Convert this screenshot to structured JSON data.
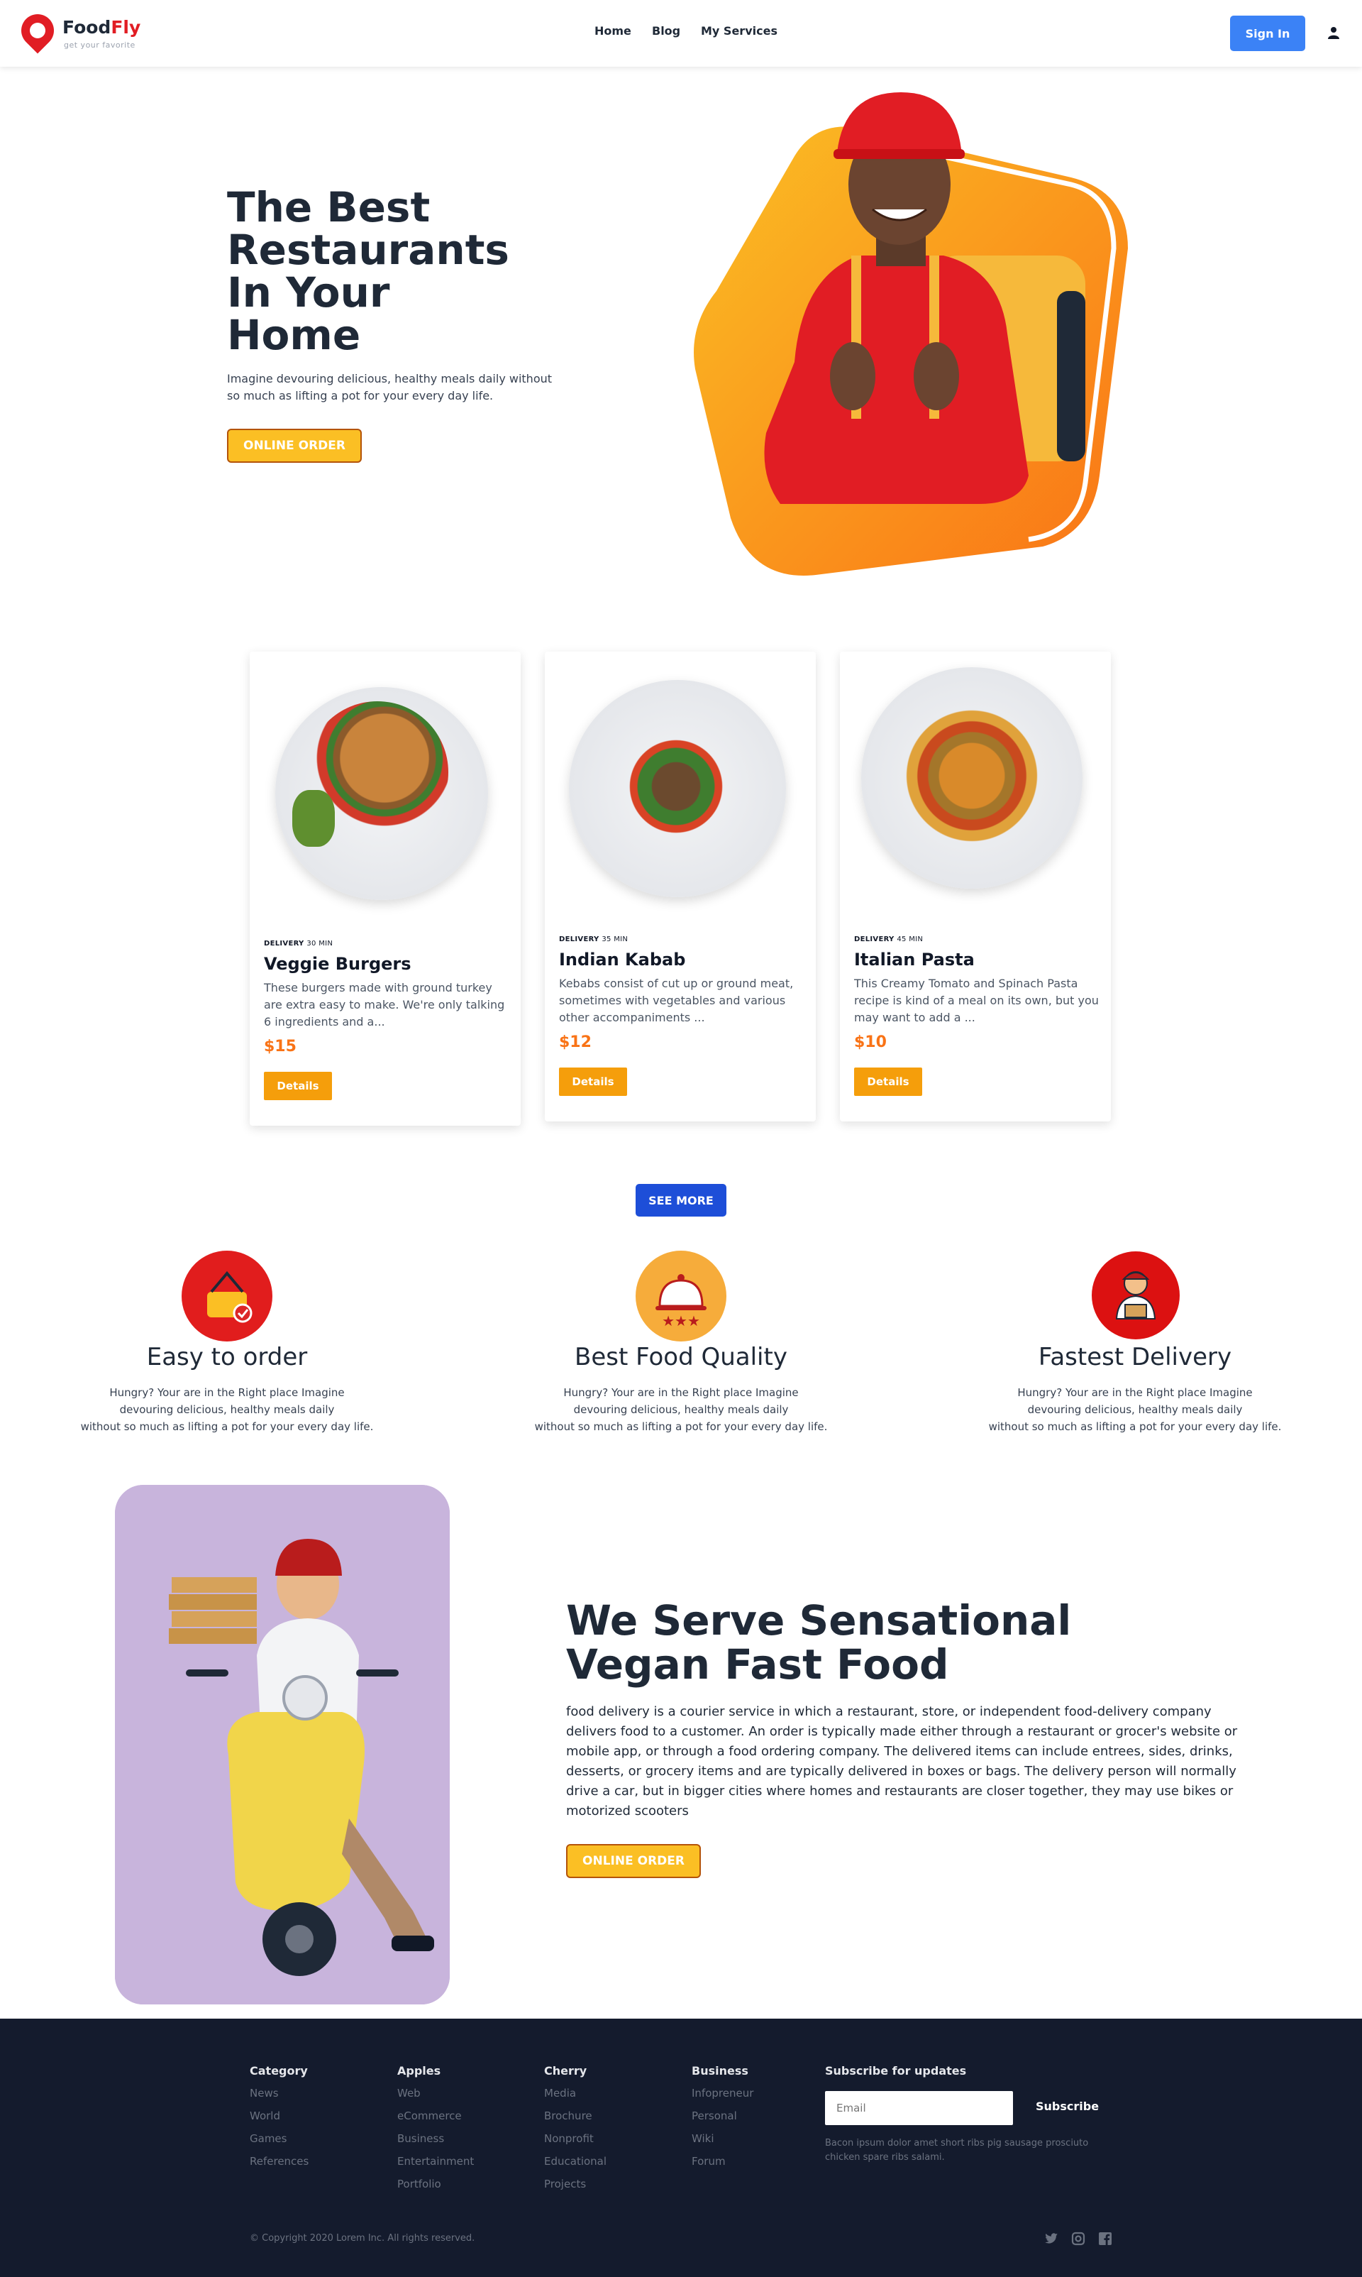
{
  "header": {
    "brand_food": "Food",
    "brand_fly": "Fly",
    "tagline": "get your favorite",
    "nav": [
      "Home",
      "Blog",
      "My Services"
    ],
    "signin": "Sign In"
  },
  "hero": {
    "title_lines": [
      "The Best",
      "Restaurants",
      "In Your",
      "Home"
    ],
    "subtitle": "Imagine devouring delicious, healthy meals daily without so much as lifting a pot for your every day life.",
    "cta": "ONLINE ORDER"
  },
  "cards": [
    {
      "delivery_label": "DELIVERY",
      "delivery_time": "30 MIN",
      "title": "Veggie Burgers",
      "desc": "These burgers made with ground turkey are extra easy to make. We're only talking 6 ingredients and a...",
      "price": "$15",
      "button": "Details"
    },
    {
      "delivery_label": "DELIVERY",
      "delivery_time": "35 MIN",
      "title": "Indian Kabab",
      "desc": "Kebabs consist of cut up or ground meat, sometimes with vegetables and various other accompaniments ...",
      "price": "$12",
      "button": "Details"
    },
    {
      "delivery_label": "DELIVERY",
      "delivery_time": "45 MIN",
      "title": "Italian Pasta",
      "desc": "This Creamy Tomato and Spinach Pasta recipe is kind of a meal on its own, but you may want to add a ...",
      "price": "$10",
      "button": "Details"
    }
  ],
  "see_more": "SEE MORE",
  "features": [
    {
      "title": "Easy to order",
      "desc_lines": [
        "Hungry? Your are in the Right place Imagine",
        "devouring delicious, healthy meals daily",
        "without so much as lifting a pot for your every day life."
      ],
      "icon": "basket-icon",
      "color": "#e11d1d"
    },
    {
      "title": "Best Food Quality",
      "desc_lines": [
        "Hungry? Your are in the Right place Imagine",
        "devouring delicious, healthy meals daily",
        "without so much as lifting a pot for your every day life."
      ],
      "icon": "cloche-icon",
      "color": "#f59e0b"
    },
    {
      "title": "Fastest Delivery",
      "desc_lines": [
        "Hungry? Your are in the Right place Imagine",
        "devouring delicious, healthy meals daily",
        "without so much as lifting a pot for your every day life."
      ],
      "icon": "delivery-man-icon",
      "color": "#dc1111"
    }
  ],
  "vegan": {
    "title_lines": [
      "We Serve Sensational",
      "Vegan Fast Food"
    ],
    "body": "food delivery is a courier service in which a restaurant, store, or independent food-delivery company delivers food to a customer. An order is typically made either through a restaurant or grocer's website or mobile app, or through a food ordering company. The delivered items can include entrees, sides, drinks, desserts, or grocery items and are typically delivered in boxes or bags. The delivery person will normally drive a car, but in bigger cities where homes and restaurants are closer together, they may use bikes or motorized scooters",
    "cta": "ONLINE ORDER"
  },
  "footer": {
    "columns": [
      {
        "head": "Category",
        "links": [
          "News",
          "World",
          "Games",
          "References"
        ]
      },
      {
        "head": "Apples",
        "links": [
          "Web",
          "eCommerce",
          "Business",
          "Entertainment",
          "Portfolio"
        ]
      },
      {
        "head": "Cherry",
        "links": [
          "Media",
          "Brochure",
          "Nonprofit",
          "Educational",
          "Projects"
        ]
      },
      {
        "head": "Business",
        "links": [
          "Infopreneur",
          "Personal",
          "Wiki",
          "Forum"
        ]
      }
    ],
    "subscribe_head": "Subscribe for updates",
    "email_placeholder": "Email",
    "subscribe_button": "Subscribe",
    "note": "Bacon ipsum dolor amet short ribs pig sausage prosciuto chicken spare ribs salami.",
    "copyright": "© Copyright 2020 Lorem Inc. All rights reserved.",
    "social": [
      "twitter-icon",
      "instagram-icon",
      "facebook-icon"
    ]
  }
}
